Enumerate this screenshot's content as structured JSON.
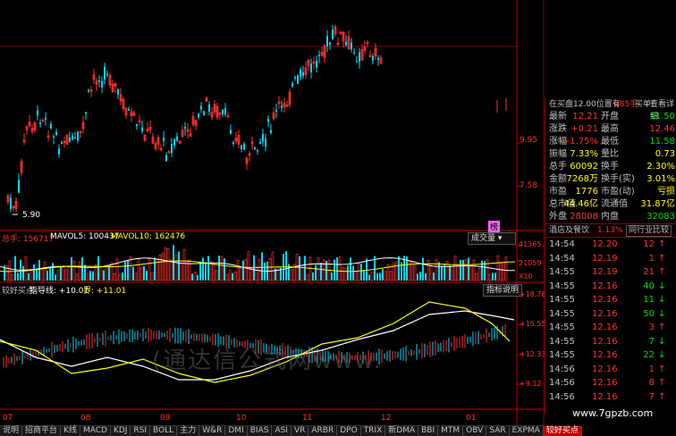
{
  "main_chart": {
    "price_labels": [
      "9.95",
      "7.58"
    ],
    "low_marker": "5.90"
  },
  "volume_panel": {
    "total_label": "总手: 156717",
    "mavol5": "MAVOL5: 100437",
    "mavol10": "MAVOL10: 162476",
    "dropdown": "成交量",
    "axis": [
      "41365",
      "21059",
      "X10"
    ],
    "badge": "榜"
  },
  "indicator_panel": {
    "name": "较好买点",
    "guide": "指导线: +10.01",
    "boundary": "界: +11.01",
    "help_button": "指标说明",
    "axis": [
      "+18.76",
      "+15.55",
      "+12.33",
      "+9.12"
    ]
  },
  "months": [
    "07",
    "08",
    "09",
    "10",
    "11",
    "12",
    "01"
  ],
  "quote": {
    "header_title": "在买盘12.00位置有",
    "header_count": "285手",
    "header_action": "买单!",
    "header_link": "查看详细",
    "rows": [
      {
        "k1": "最新",
        "v1": "12.21",
        "c1": "up",
        "k2": "开盘",
        "v2": "11.50",
        "c2": "dn"
      },
      {
        "k1": "涨跌",
        "v1": "+0.21",
        "c1": "up",
        "k2": "最高",
        "v2": "12.46",
        "c2": "up"
      },
      {
        "k1": "涨幅",
        "v1": "+1.75%",
        "c1": "up",
        "k2": "最低",
        "v2": "11.58",
        "c2": "dn"
      },
      {
        "k1": "振幅",
        "v1": "7.33%",
        "c1": "yl",
        "k2": "量比",
        "v2": "0.73",
        "c2": "yl"
      },
      {
        "k1": "总手",
        "v1": "60092",
        "c1": "yl",
        "k2": "换手",
        "v2": "2.30%",
        "c2": "yl"
      },
      {
        "k1": "金额",
        "v1": "7268万",
        "c1": "yl",
        "k2": "换手(实)",
        "v2": "3.01%",
        "c2": "yl"
      },
      {
        "k1": "市盈",
        "v1": "1776",
        "c1": "yl",
        "k2": "市盈(动)",
        "v2": "亏损",
        "c2": "yl"
      },
      {
        "k1": "总市值",
        "v1": "44.46亿",
        "c1": "yl",
        "k2": "流通值",
        "v2": "31.87亿",
        "c2": "yl"
      },
      {
        "k1": "外盘",
        "v1": "28008",
        "c1": "up",
        "k2": "内盘",
        "v2": "32083",
        "c2": "dn"
      }
    ],
    "industry": "酒店及餐饮",
    "industry_pct": "1.13%",
    "compare_button": "同行业比较",
    "ticks": [
      {
        "time": "14:54",
        "price": "12.20",
        "vol": "12",
        "dir": "up"
      },
      {
        "time": "14:54",
        "price": "12.19",
        "vol": "1",
        "dir": "up"
      },
      {
        "time": "14:55",
        "price": "12.19",
        "vol": "21",
        "dir": "up"
      },
      {
        "time": "14:55",
        "price": "12.16",
        "vol": "40",
        "dir": "dn"
      },
      {
        "time": "14:55",
        "price": "12.16",
        "vol": "11",
        "dir": "dn"
      },
      {
        "time": "14:55",
        "price": "12.16",
        "vol": "50",
        "dir": "dn"
      },
      {
        "time": "14:55",
        "price": "12.16",
        "vol": "3",
        "dir": "up"
      },
      {
        "time": "14:55",
        "price": "12.16",
        "vol": "7",
        "dir": "dn"
      },
      {
        "time": "14:55",
        "price": "12.16",
        "vol": "22",
        "dir": "dn"
      },
      {
        "time": "14:56",
        "price": "12.16",
        "vol": "1",
        "dir": "up"
      },
      {
        "time": "14:56",
        "price": "12.16",
        "vol": "8",
        "dir": "up"
      },
      {
        "time": "14:56",
        "price": "12.16",
        "vol": "7",
        "dir": "up"
      }
    ]
  },
  "tabs": [
    "说明",
    "招商平台",
    "K线",
    "MACD",
    "KDJ",
    "RSI",
    "BOLL",
    "主力",
    "W&R",
    "DMI",
    "BIAS",
    "ASI",
    "VR",
    "ARBR",
    "DPO",
    "TRIX",
    "新DMA",
    "BBI",
    "MTM",
    "OBV",
    "SAR",
    "EXPMA",
    "较好买点"
  ],
  "active_tab": "较好买点",
  "watermark_site": "www.7gpzb.com",
  "watermark_big": "(通达信公式网www."
}
